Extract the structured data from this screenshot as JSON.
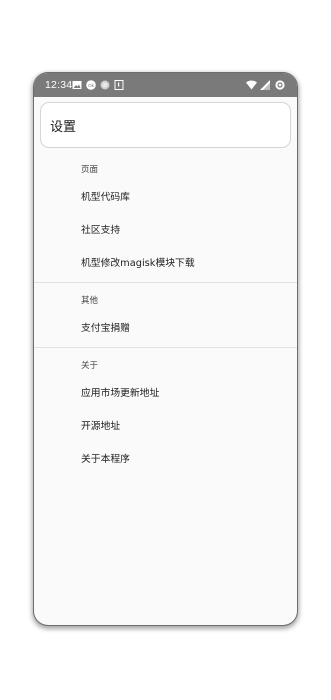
{
  "status_bar": {
    "time": "12:34",
    "icons_left": [
      "image-icon",
      "badge-icon",
      "circle-icon",
      "sim-icon"
    ],
    "icons_right": [
      "wifi-icon",
      "signal-icon",
      "battery-icon"
    ],
    "background": "#7a7a7a"
  },
  "toolbar": {
    "title": "设置"
  },
  "sections": [
    {
      "header": "页面",
      "items": [
        "机型代码库",
        "社区支持",
        "机型修改magisk模块下载"
      ]
    },
    {
      "header": "其他",
      "items": [
        "支付宝捐赠"
      ]
    },
    {
      "header": "关于",
      "items": [
        "应用市场更新地址",
        "开源地址",
        "关于本程序"
      ]
    }
  ]
}
